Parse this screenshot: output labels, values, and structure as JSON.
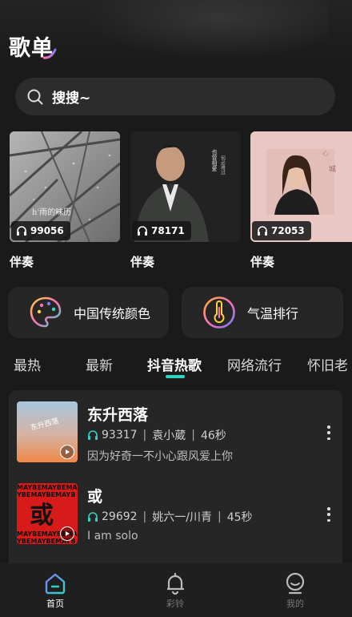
{
  "header": {
    "title": "歌单"
  },
  "search": {
    "label": "搜搜~"
  },
  "playlists": [
    {
      "title": "伴奏",
      "plays": "99056"
    },
    {
      "title": "伴奏",
      "plays": "78171"
    },
    {
      "title": "伴奏",
      "plays": "72053"
    }
  ],
  "features": [
    {
      "label": "中国传统颜色",
      "icon": "palette-icon"
    },
    {
      "label": "气温排行",
      "icon": "thermometer-icon"
    }
  ],
  "tabs": [
    {
      "label": "最热"
    },
    {
      "label": "最新"
    },
    {
      "label": "抖音热歌",
      "active": true
    },
    {
      "label": "网络流行"
    },
    {
      "label": "怀旧老"
    }
  ],
  "songs": [
    {
      "title": "东升西落",
      "plays": "93317",
      "artist": "袁小葳",
      "duration": "46秒",
      "desc": "因为好奇一不小心跟风爱上你"
    },
    {
      "title": "或",
      "plays": "29692",
      "artist": "姚六一/川青",
      "duration": "45秒",
      "desc": "I am solo"
    }
  ],
  "nav": [
    {
      "label": "首页",
      "icon": "home-icon",
      "active": true
    },
    {
      "label": "彩铃",
      "icon": "bell-icon"
    },
    {
      "label": "我的",
      "icon": "profile-icon"
    }
  ],
  "colors": {
    "accent": "#2fd4c2",
    "background": "#1a1a1a",
    "card": "#262626"
  }
}
